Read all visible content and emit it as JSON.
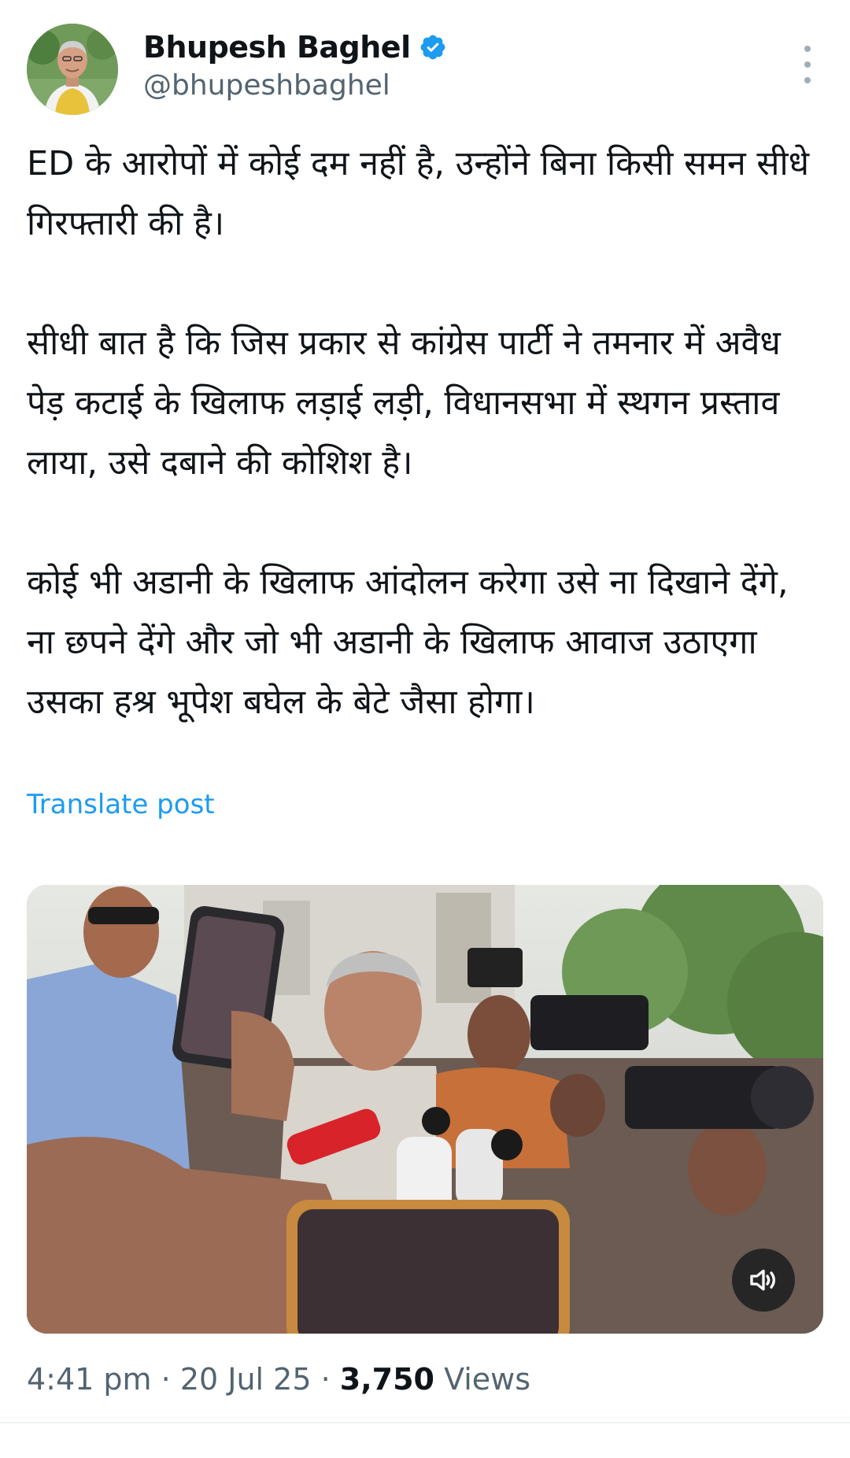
{
  "author": {
    "display_name": "Bhupesh Baghel",
    "handle": "@bhupeshbaghel",
    "verified": true
  },
  "icons": {
    "verified": "verified-badge-icon",
    "more": "more-options-icon",
    "mute": "speaker-muted-icon"
  },
  "colors": {
    "link": "#1d9bf0",
    "verified": "#1d9bf0",
    "secondary_text": "#536471",
    "primary_text": "#0f1419"
  },
  "tweet": {
    "paragraphs": [
      "ED के आरोपों में कोई दम नहीं है, उन्होंने बिना किसी समन सीधे गिरफ्तारी की है।",
      "सीधी बात है कि जिस प्रकार से कांग्रेस पार्टी ने तमनार में अवैध पेड़ कटाई के खिलाफ लड़ाई लड़ी, विधानसभा में स्थगन प्रस्ताव लाया, उसे दबाने की कोशिश है।",
      "कोई भी अडानी के खिलाफ आंदोलन करेगा उसे ना दिखाने देंगे, ना छपने देंगे और जो भी अडानी के खिलाफ आवाज उठाएगा उसका हश्र भूपेश बघेल के बेटे जैसा होगा।"
    ],
    "translate_label": "Translate post"
  },
  "meta": {
    "time": "4:41 pm",
    "separator": " · ",
    "date": "20 Jul 25",
    "views_count": "3,750",
    "views_label": " Views"
  }
}
